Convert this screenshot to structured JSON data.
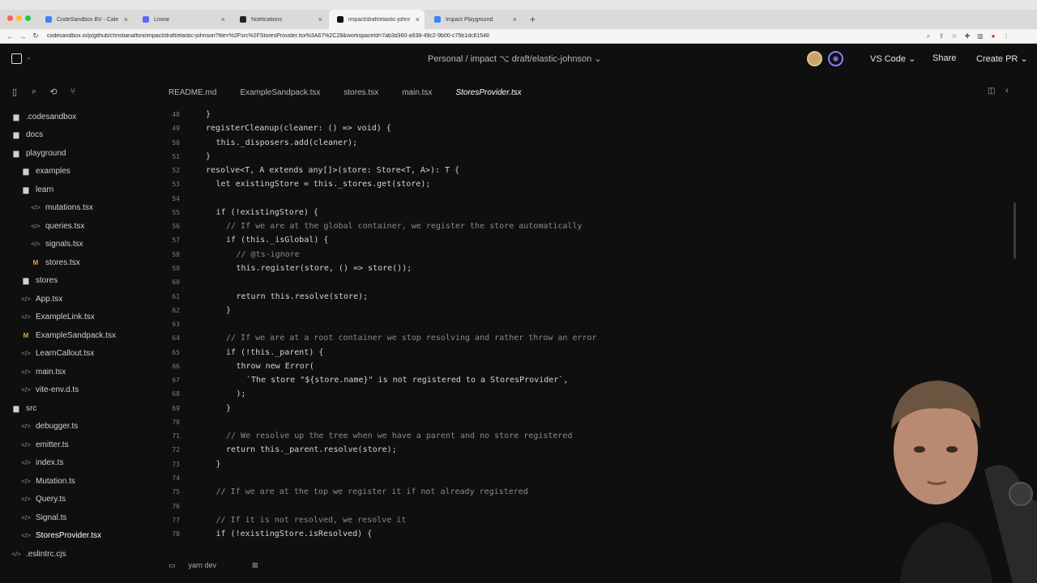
{
  "browser": {
    "tabs": [
      {
        "label": "CodeSandbox BV - Calendar",
        "color": "#3b82f6",
        "active": false
      },
      {
        "label": "Linear",
        "color": "#6366f1",
        "active": false
      },
      {
        "label": "Notifications",
        "color": "#222222",
        "active": false
      },
      {
        "label": "impact/draft/elastic-johnson",
        "color": "#111111",
        "active": true
      },
      {
        "label": "Impact Playground",
        "color": "#3b82f6",
        "active": false
      }
    ],
    "new_tab": "+",
    "url": "codesandbox.io/p/github/christianalfoni/impact/draft/elastic-johnson?file=%2Fsrc%2FStoresProvider.tsx%3A67%2C28&workspaceId=7ab3d360-a938-49c2-9b00-c75b1dc61548"
  },
  "header": {
    "branch": "Personal / impact  ⌥  draft/elastic-johnson  ⌄",
    "vscode_label": "VS Code  ⌄",
    "share_label": "Share",
    "create_pr_label": "Create PR  ⌄"
  },
  "sidebar": {
    "items": [
      {
        "label": ".codesandbox",
        "kind": "folder",
        "depth": 0
      },
      {
        "label": "docs",
        "kind": "folder",
        "depth": 0
      },
      {
        "label": "playground",
        "kind": "folder-open",
        "depth": 0
      },
      {
        "label": "examples",
        "kind": "folder",
        "depth": 1
      },
      {
        "label": "learn",
        "kind": "folder-open",
        "depth": 1
      },
      {
        "label": "mutations.tsx",
        "kind": "tsx",
        "depth": 2
      },
      {
        "label": "queries.tsx",
        "kind": "tsx",
        "depth": 2
      },
      {
        "label": "signals.tsx",
        "kind": "tsx",
        "depth": 2
      },
      {
        "label": "stores.tsx",
        "kind": "m",
        "depth": 2
      },
      {
        "label": "stores",
        "kind": "folder",
        "depth": 1
      },
      {
        "label": "App.tsx",
        "kind": "tsx",
        "depth": 1
      },
      {
        "label": "ExampleLink.tsx",
        "kind": "tsx",
        "depth": 1
      },
      {
        "label": "ExampleSandpack.tsx",
        "kind": "m",
        "depth": 1
      },
      {
        "label": "LearnCallout.tsx",
        "kind": "tsx",
        "depth": 1
      },
      {
        "label": "main.tsx",
        "kind": "tsx",
        "depth": 1
      },
      {
        "label": "vite-env.d.ts",
        "kind": "tsx",
        "depth": 1
      },
      {
        "label": "src",
        "kind": "folder-open",
        "depth": 0
      },
      {
        "label": "debugger.ts",
        "kind": "tsx",
        "depth": 1
      },
      {
        "label": "emitter.ts",
        "kind": "tsx",
        "depth": 1
      },
      {
        "label": "index.ts",
        "kind": "tsx",
        "depth": 1
      },
      {
        "label": "Mutation.ts",
        "kind": "tsx",
        "depth": 1
      },
      {
        "label": "Query.ts",
        "kind": "tsx",
        "depth": 1
      },
      {
        "label": "Signal.ts",
        "kind": "tsx",
        "depth": 1
      },
      {
        "label": "StoresProvider.tsx",
        "kind": "tsx",
        "depth": 1,
        "active": true
      },
      {
        "label": ".eslintrc.cjs",
        "kind": "tsx",
        "depth": 0
      }
    ]
  },
  "editor_tabs": [
    {
      "label": "README.md",
      "active": false
    },
    {
      "label": "ExampleSandpack.tsx",
      "active": false
    },
    {
      "label": "stores.tsx",
      "active": false
    },
    {
      "label": "main.tsx",
      "active": false
    },
    {
      "label": "StoresProvider.tsx",
      "active": true
    }
  ],
  "code_lines": [
    {
      "n": "48",
      "indent": 0,
      "text": "}",
      "type": "code"
    },
    {
      "n": "49",
      "indent": 0,
      "text": "registerCleanup(cleaner: () => void) {",
      "type": "code"
    },
    {
      "n": "50",
      "indent": 1,
      "text": "this._disposers.add(cleaner);",
      "type": "code"
    },
    {
      "n": "51",
      "indent": 0,
      "text": "}",
      "type": "code"
    },
    {
      "n": "52",
      "indent": 0,
      "text": "resolve<T, A extends any[]>(store: Store<T, A>): T {",
      "type": "code"
    },
    {
      "n": "53",
      "indent": 1,
      "text": "let existingStore = this._stores.get(store);",
      "type": "code"
    },
    {
      "n": "54",
      "indent": 0,
      "text": "",
      "type": "code"
    },
    {
      "n": "55",
      "indent": 1,
      "text": "if (!existingStore) {",
      "type": "code"
    },
    {
      "n": "56",
      "indent": 2,
      "text": "// If we are at the global container, we register the store automatically",
      "type": "comment"
    },
    {
      "n": "57",
      "indent": 2,
      "text": "if (this._isGlobal) {",
      "type": "code"
    },
    {
      "n": "58",
      "indent": 3,
      "text": "// @ts-ignore",
      "type": "comment"
    },
    {
      "n": "59",
      "indent": 3,
      "text": "this.register(store, () => store());",
      "type": "code"
    },
    {
      "n": "60",
      "indent": 0,
      "text": "",
      "type": "code"
    },
    {
      "n": "61",
      "indent": 3,
      "text": "return this.resolve(store);",
      "type": "code"
    },
    {
      "n": "62",
      "indent": 2,
      "text": "}",
      "type": "code"
    },
    {
      "n": "63",
      "indent": 0,
      "text": "",
      "type": "code"
    },
    {
      "n": "64",
      "indent": 2,
      "text": "// If we are at a root container we stop resolving and rather throw an error",
      "type": "comment"
    },
    {
      "n": "65",
      "indent": 2,
      "text": "if (!this._parent) {",
      "type": "code"
    },
    {
      "n": "66",
      "indent": 3,
      "text": "throw new Error(",
      "type": "code"
    },
    {
      "n": "67",
      "indent": 4,
      "text": "`The store \"${store.name}\" is not registered to a StoresProvider`,",
      "type": "code"
    },
    {
      "n": "68",
      "indent": 3,
      "text": ");",
      "type": "code"
    },
    {
      "n": "69",
      "indent": 2,
      "text": "}",
      "type": "code"
    },
    {
      "n": "70",
      "indent": 0,
      "text": "",
      "type": "code"
    },
    {
      "n": "71",
      "indent": 2,
      "text": "// We resolve up the tree when we have a parent and no store registered",
      "type": "comment"
    },
    {
      "n": "72",
      "indent": 2,
      "text": "return this._parent.resolve(store);",
      "type": "code"
    },
    {
      "n": "73",
      "indent": 1,
      "text": "}",
      "type": "code"
    },
    {
      "n": "74",
      "indent": 0,
      "text": "",
      "type": "code"
    },
    {
      "n": "75",
      "indent": 1,
      "text": "// If we are at the top we register it if not already registered",
      "type": "comment"
    },
    {
      "n": "76",
      "indent": 0,
      "text": "",
      "type": "code"
    },
    {
      "n": "77",
      "indent": 1,
      "text": "// If it is not resolved, we resolve it",
      "type": "comment"
    },
    {
      "n": "78",
      "indent": 1,
      "text": "if (!existingStore.isResolved) {",
      "type": "code"
    }
  ],
  "status": {
    "terminal": "yarn dev"
  },
  "colors": {
    "background": "#0f0f0f",
    "comment": "#8a8a8a",
    "line_number": "#7d7d7d",
    "accent": "#8a7dff"
  }
}
